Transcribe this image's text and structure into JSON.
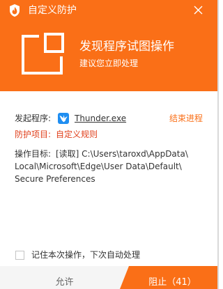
{
  "titlebar": {
    "title": "自定义防护",
    "app_icon": "flame-shield-icon",
    "close_icon": "close-icon"
  },
  "header": {
    "icon": "window-alert-icon",
    "headline": "发现程序试图操作",
    "subline": "建议您立即处理"
  },
  "details": {
    "initiator_label": "发起程序:",
    "program_icon": "thunder-bird-icon",
    "program_name": "Thunder.exe",
    "end_process_label": "结束进程",
    "protection_label": "防护项目:",
    "protection_value": "自定义规则",
    "target_label": "操作目标:",
    "target_lines": [
      "[读取] C:\\Users\\taroxd\\AppData\\",
      "Local\\Microsoft\\Edge\\User Data\\Default\\",
      "Secure Preferences"
    ]
  },
  "remember": {
    "checked": false,
    "label": "记住本次操作，下次自动处理"
  },
  "footer": {
    "allow_label": "允许",
    "block_label": "阻止（41）"
  },
  "colors": {
    "accent": "#fa6f17",
    "warning_text": "#e0401c",
    "body_text": "#333333",
    "footer_bg": "#f5f5f5"
  }
}
